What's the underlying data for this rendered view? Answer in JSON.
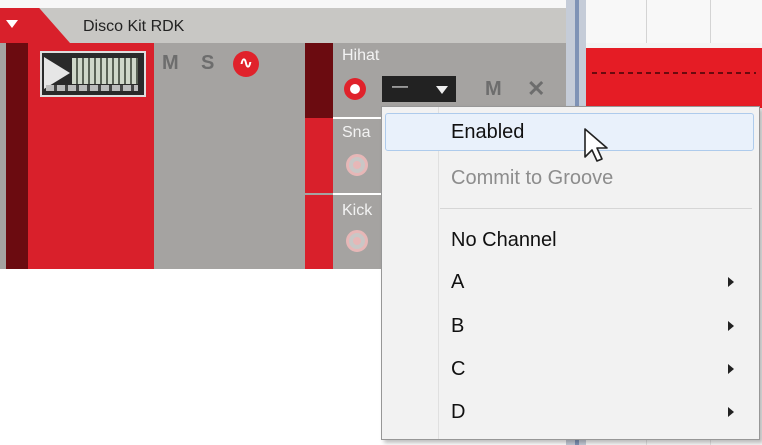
{
  "device": {
    "title": "Disco Kit RDK",
    "mute_label": "M",
    "solo_label": "S",
    "wave_icon": "waveform-icon"
  },
  "pads": [
    {
      "name": "Hihat",
      "record_active": true,
      "channel_value": "—",
      "mute_label": "M",
      "close_label": "✕"
    },
    {
      "name": "Sna",
      "record_active": false
    },
    {
      "name": "Kick",
      "record_active": false
    }
  ],
  "context_menu": {
    "items": [
      {
        "label": "Enabled",
        "state": "highlighted"
      },
      {
        "label": "Commit to Groove",
        "state": "disabled"
      },
      {
        "label": "No Channel",
        "state": "normal"
      },
      {
        "label": "A",
        "submenu": true
      },
      {
        "label": "B",
        "submenu": true
      },
      {
        "label": "C",
        "submenu": true
      },
      {
        "label": "D",
        "submenu": true
      }
    ]
  },
  "colors": {
    "accent_red": "#d9202b",
    "dark_red": "#6b0b10",
    "panel_gray": "#a5a3a1",
    "menu_bg": "#f2f2f2",
    "menu_highlight": "#e9f1fb"
  }
}
